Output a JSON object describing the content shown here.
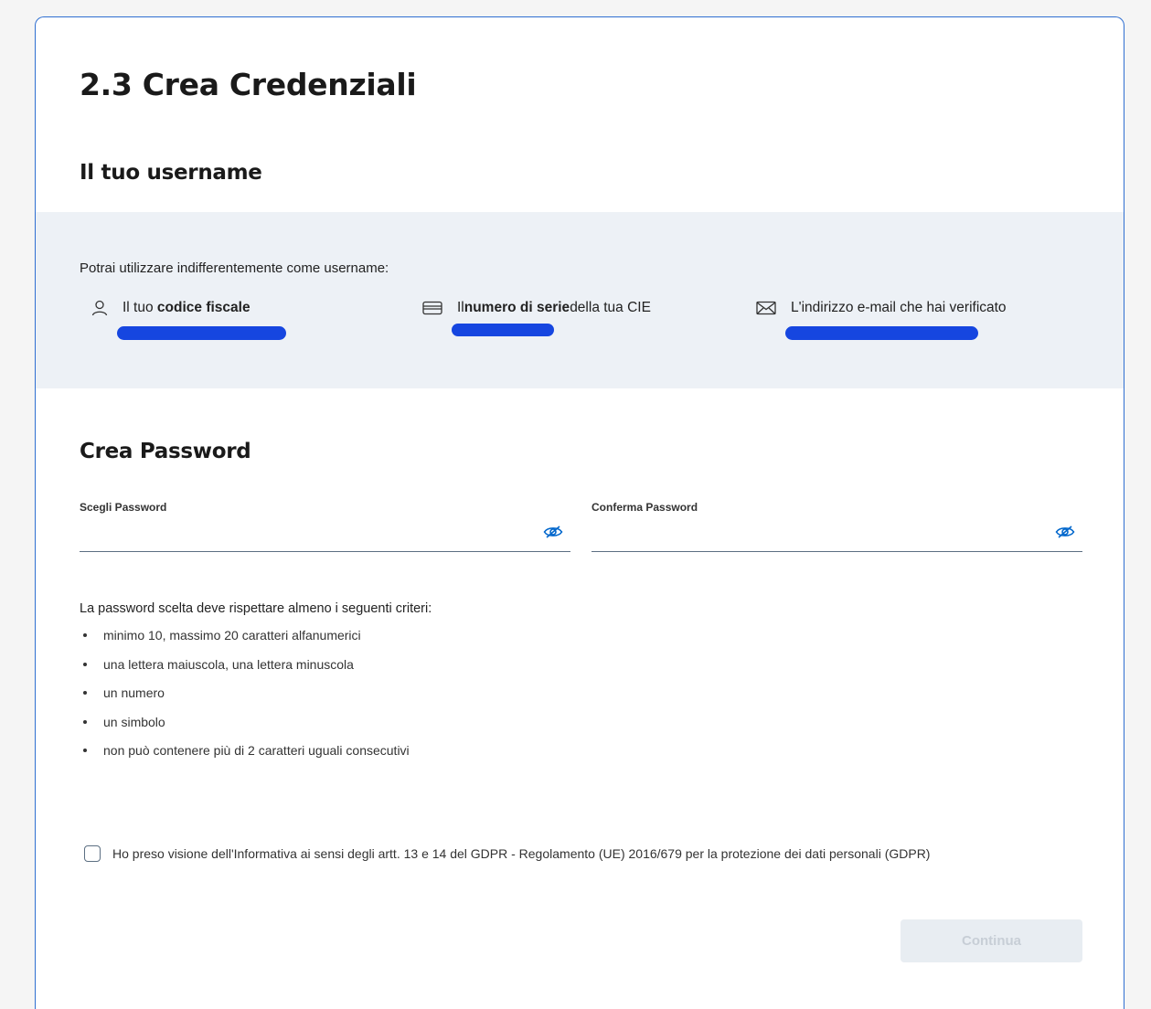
{
  "page": {
    "title": "2.3 Crea Credenziali"
  },
  "username": {
    "heading": "Il tuo username",
    "intro": "Potrai utilizzare indifferentemente come username:",
    "codice_fiscale": {
      "prefix": "Il tuo ",
      "bold": "codice fiscale",
      "suffix": ""
    },
    "numero_serie": {
      "prefix": "Il",
      "bold": "numero di serie",
      "suffix": "della tua CIE"
    },
    "email": {
      "text": "L'indirizzo e-mail che hai verificato"
    },
    "redaction_color": "#1646e0"
  },
  "password": {
    "heading": "Crea Password",
    "choose_label": "Scegli Password",
    "confirm_label": "Conferma Password",
    "criteria_intro": "La password scelta deve rispettare almeno i seguenti criteri:",
    "criteria": [
      "minimo 10, massimo 20 caratteri alfanumerici",
      "una lettera maiuscola, una lettera minuscola",
      "un numero",
      "un simbolo",
      "non può contenere più di 2 caratteri uguali consecutivi"
    ]
  },
  "consent": {
    "label": "Ho preso visione dell'Informativa ai sensi degli artt. 13 e 14 del GDPR - Regolamento (UE) 2016/679 per la protezione dei dati personali (GDPR)",
    "checked": false
  },
  "actions": {
    "continue_label": "Continua",
    "continue_disabled": true
  },
  "colors": {
    "accent": "#0066cc",
    "band_background": "#edf1f6",
    "card_border": "#2f6fd1"
  },
  "icons": {
    "codice_fiscale": "user-icon",
    "numero_serie": "card-icon",
    "email": "envelope-icon",
    "password_toggle": "eye-icon"
  }
}
